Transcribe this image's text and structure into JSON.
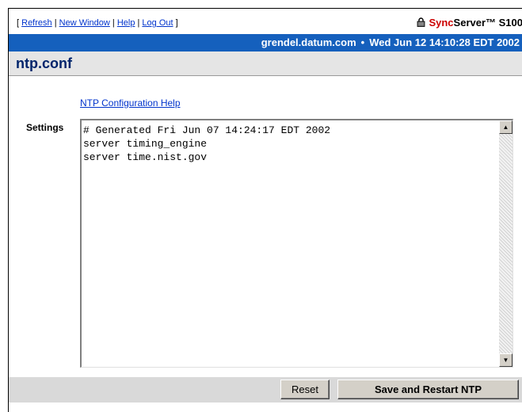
{
  "top_links": {
    "open_bracket": "[",
    "refresh": "Refresh",
    "new_window": "New Window",
    "help": "Help",
    "log_out": "Log Out",
    "close_bracket": "]",
    "separator": "|"
  },
  "brand": {
    "sync": "Sync",
    "rest": "Server™ S100",
    "icon": "lock-icon",
    "sync_color": "#cc0000"
  },
  "status_bar": {
    "host": "grendel.datum.com",
    "bullet": "•",
    "datetime": "Wed Jun 12 14:10:28 EDT 2002",
    "background_color": "#1560bd"
  },
  "page": {
    "title": "ntp.conf",
    "title_color": "#00246b",
    "help_link": "NTP Configuration Help"
  },
  "settings": {
    "label": "Settings",
    "content": "# Generated Fri Jun 07 14:24:17 EDT 2002\nserver timing_engine\nserver time.nist.gov"
  },
  "buttons": {
    "reset": "Reset",
    "save_restart": "Save and Restart NTP"
  }
}
